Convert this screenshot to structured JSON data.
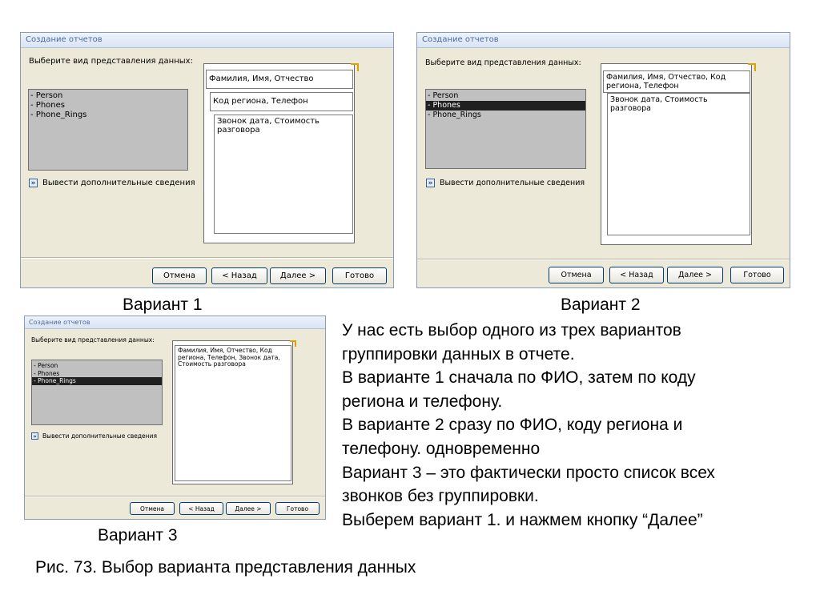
{
  "dialogs": [
    {
      "title": "Создание отчетов",
      "prompt": "Выберите вид представления данных:",
      "list_items": [
        "- Person",
        "- Phones",
        "- Phone_Rings"
      ],
      "selected_index": 0,
      "more_icon": "»",
      "more_label": "Вывести дополнительные сведения",
      "groups": [
        "Фамилия, Имя, Отчество",
        "Код региона, Телефон",
        "Звонок дата, Стоимость разговора"
      ],
      "buttons": {
        "cancel": "Отмена",
        "back": "< Назад",
        "next": "Далее >",
        "finish": "Готово"
      }
    },
    {
      "title": "Создание отчетов",
      "prompt": "Выберите вид представления данных:",
      "list_items": [
        "- Person",
        "- Phones",
        "- Phone_Rings"
      ],
      "selected_index": 1,
      "more_icon": "»",
      "more_label": "Вывести дополнительные сведения",
      "groups": [
        "Фамилия, Имя, Отчество, Код региона, Телефон",
        "Звонок дата, Стоимость разговора"
      ],
      "buttons": {
        "cancel": "Отмена",
        "back": "< Назад",
        "next": "Далее >",
        "finish": "Готово"
      }
    },
    {
      "title": "Создание отчетов",
      "prompt": "Выберите вид представления данных:",
      "list_items": [
        "- Person",
        "- Phones",
        "- Phone_Rings"
      ],
      "selected_index": 2,
      "more_icon": "»",
      "more_label": "Вывести дополнительные сведения",
      "groups": [
        "Фамилия, Имя, Отчество, Код региона, Телефон, Звонок дата, Стоимость разговора"
      ],
      "buttons": {
        "cancel": "Отмена",
        "back": "< Назад",
        "next": "Далее >",
        "finish": "Готово"
      }
    }
  ],
  "captions": {
    "variant1": "Вариант 1",
    "variant2": "Вариант 2",
    "variant3": "Вариант 3"
  },
  "explanation": [
    "У нас есть выбор одного из трех вариантов",
    "группировки данных в отчете.",
    "В варианте 1 сначала по ФИО, затем по коду",
    "региона и телефону.",
    "В варианте 2 сразу по ФИО, коду региона и",
    "телефону.  одновременно",
    "Вариант 3 – это фактически просто список всех",
    "звонков без группировки.",
    "Выберем вариант 1. и нажмем кнопку “Далее”"
  ],
  "figure_caption": "Рис. 73. Выбор варианта представления данных",
  "colors": {
    "dialog_bg": "#ece9d8",
    "title_text": "#4a6aa0",
    "list_bg": "#c0c0c0",
    "selected_bg": "#202020",
    "corner_accent": "#e0a000"
  }
}
